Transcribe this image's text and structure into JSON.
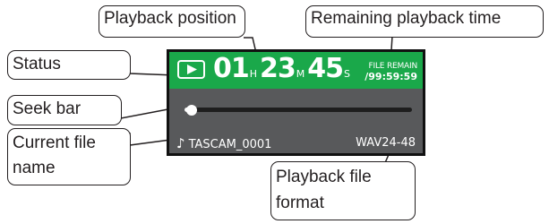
{
  "screen": {
    "status_icon": "play-icon",
    "time": {
      "hours": "01",
      "hours_unit": "H",
      "minutes": "23",
      "minutes_unit": "M",
      "seconds": "45",
      "seconds_unit": "S"
    },
    "remaining": {
      "label": "FILE REMAIN",
      "value": "/99:59:59"
    },
    "seek": {
      "position_fraction": 0.03
    },
    "file": {
      "note_icon": "music-note-icon",
      "name": "TASCAM_0001",
      "format": "WAV24-48"
    },
    "colors": {
      "status_bar": "#1aa84a",
      "screen_bg": "#58595b",
      "text": "#ffffff"
    }
  },
  "callouts": {
    "playback_position": "Playback position",
    "remaining_time": "Remaining playback time",
    "status": "Status",
    "seek_bar": "Seek bar",
    "current_file_line1": "Current file",
    "current_file_line2": "name",
    "file_format_line1": "Playback file",
    "file_format_line2": "format"
  }
}
